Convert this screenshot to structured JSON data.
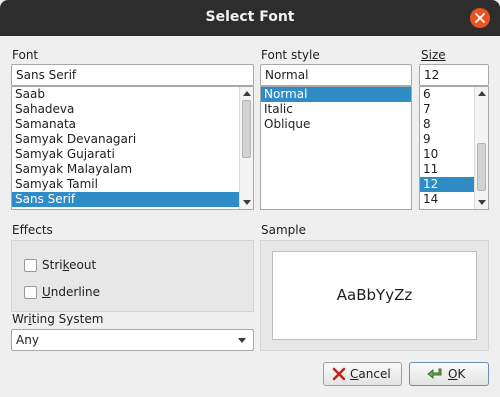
{
  "window": {
    "title": "Select Font"
  },
  "font": {
    "label": "Font",
    "value": "Sans Serif",
    "items": [
      "Saab",
      "Sahadeva",
      "Samanata",
      "Samyak Devanagari",
      "Samyak Gujarati",
      "Samyak Malayalam",
      "Samyak Tamil",
      "Sans Serif"
    ],
    "selected": "Sans Serif"
  },
  "style": {
    "label": "Font style",
    "value": "Normal",
    "items": [
      "Normal",
      "Italic",
      "Oblique"
    ],
    "selected": "Normal"
  },
  "size": {
    "label": "Size",
    "value": "12",
    "items": [
      "6",
      "7",
      "8",
      "9",
      "10",
      "11",
      "12",
      "14"
    ],
    "selected": "12"
  },
  "effects": {
    "label": "Effects",
    "strikeout": {
      "pre": "Stri",
      "mn": "k",
      "post": "eout"
    },
    "underline": {
      "pre": "",
      "mn": "U",
      "post": "nderline"
    }
  },
  "writing": {
    "label_pre": "Wr",
    "label_mn": "i",
    "label_post": "ting System",
    "value": "Any"
  },
  "sample": {
    "label": "Sample",
    "text": "AaBbYyZz"
  },
  "buttons": {
    "cancel": {
      "mn": "C",
      "rest": "ancel"
    },
    "ok": {
      "mn": "O",
      "rest": "K"
    }
  },
  "colors": {
    "accent": "#e95420",
    "selection": "#308cc6",
    "titlebar": "#2d2d2d"
  }
}
